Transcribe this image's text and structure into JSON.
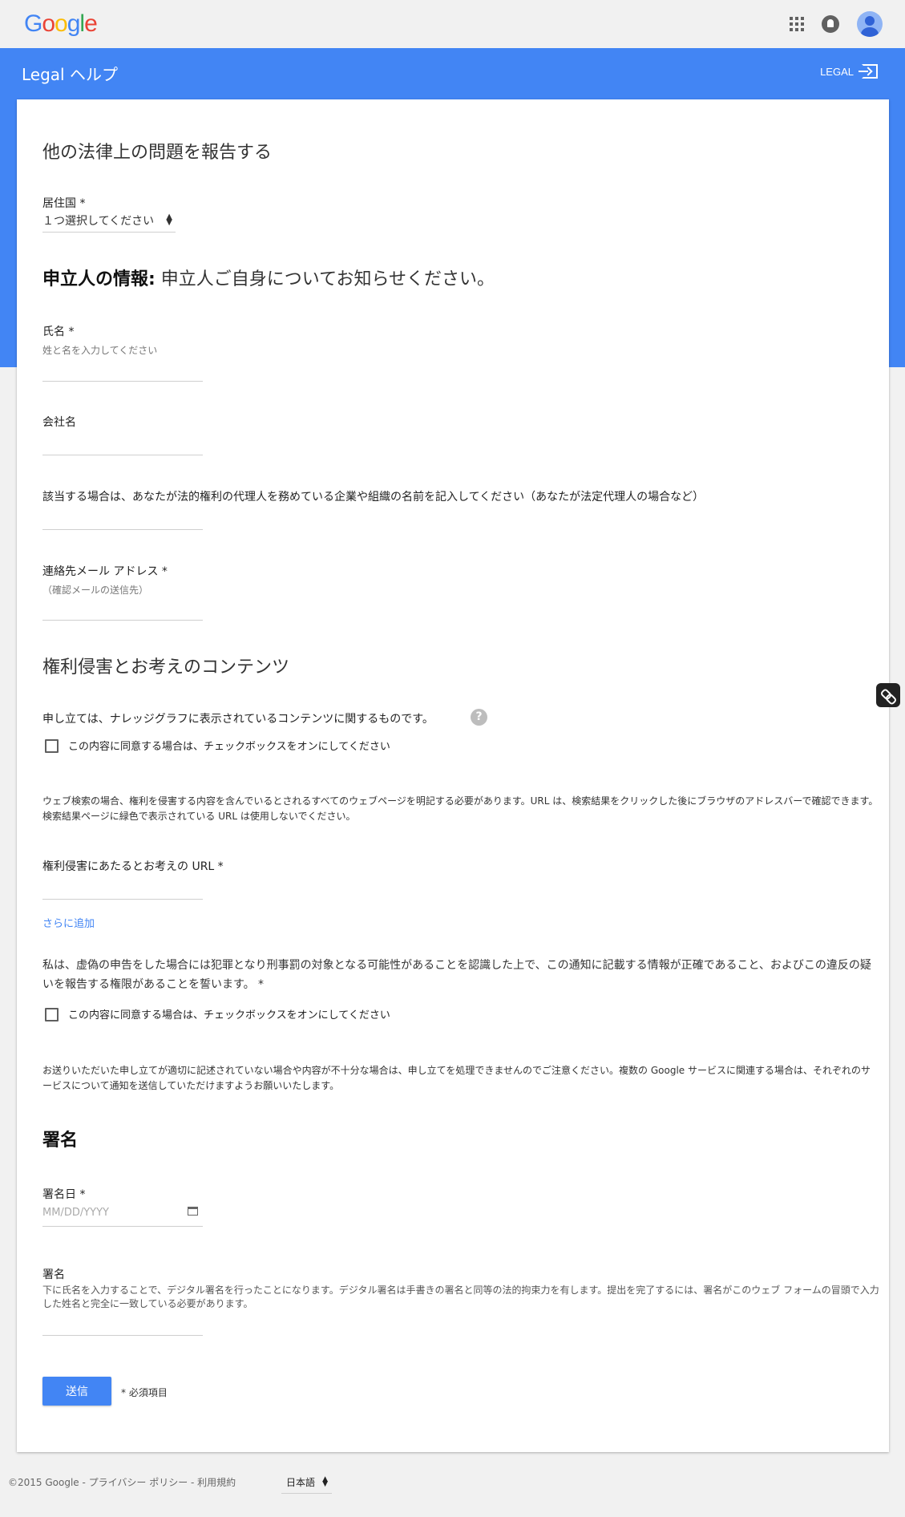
{
  "header": {
    "logo_text": "Google",
    "logo_colors": [
      "#4285f4",
      "#ea4335",
      "#fbbc05",
      "#4285f4",
      "#34a853",
      "#ea4335"
    ],
    "help_title": "Legal ヘルプ",
    "legal_link": "LEGAL",
    "accent": "#4285f4",
    "icons": [
      "apps-icon",
      "notifications-icon",
      "avatar",
      "exit-icon"
    ]
  },
  "form": {
    "title": "他の法律上の問題を報告する",
    "country": {
      "label": "居住国 *",
      "selected": "１つ選択してください"
    },
    "applicant": {
      "heading_bold": "申立人の情報:",
      "heading_rest": " 申立人ご自身についてお知らせください。",
      "name_label": "氏名 *",
      "name_hint": "姓と名を入力してください",
      "company_label": "会社名",
      "represented_label": "該当する場合は、あなたが法的権利の代理人を務めている企業や組織の名前を記入してください（あなたが法定代理人の場合など）",
      "email_label": "連絡先メール アドレス *",
      "email_hint": "（確認メールの送信先）"
    },
    "content": {
      "heading": "権利侵害とお考えのコンテンツ",
      "knowledge_graph_text": "申し立ては、ナレッジグラフに表示されているコンテンツに関するものです。",
      "help_icon": "?",
      "checkbox1_label": "この内容に同意する場合は、チェックボックスをオンにしてください",
      "web_search_note": "ウェブ検索の場合、権利を侵害する内容を含んでいるとされるすべてのウェブページを明記する必要があります。URL は、検索結果をクリックした後にブラウザのアドレスバーで確認できます。検索結果ページに緑色で表示されている URL は使用しないでください。",
      "url_label": "権利侵害にあたるとお考えの URL *",
      "add_more": "さらに追加",
      "declaration": "私は、虚偽の申告をした場合には犯罪となり刑事罰の対象となる可能性があることを認識した上で、この通知に記載する情報が正確であること、およびこの違反の疑いを報告する権限があることを誓います。 *",
      "checkbox2_label": "この内容に同意する場合は、チェックボックスをオンにしてください",
      "notice": "お送りいただいた申し立てが適切に記述されていない場合や内容が不十分な場合は、申し立てを処理できませんのでご注意ください。複数の Google サービスに関連する場合は、それぞれのサービスについて通知を送信していただけますようお願いいたします。"
    },
    "signature": {
      "heading": "署名",
      "date_label": "署名日 *",
      "date_placeholder": "MM/DD/YYYY",
      "signature_label": "署名",
      "signature_hint": "下に氏名を入力することで、デジタル署名を行ったことになります。デジタル署名は手書きの署名と同等の法的拘束力を有します。提出を完了するには、署名がこのウェブ フォームの冒頭で入力した姓名と完全に一致している必要があります。"
    },
    "submit_label": "送信",
    "required_note": "* 必須項目"
  },
  "footer": {
    "text": "©2015 Google - プライバシー ポリシー - 利用規約",
    "language": "日本語"
  }
}
